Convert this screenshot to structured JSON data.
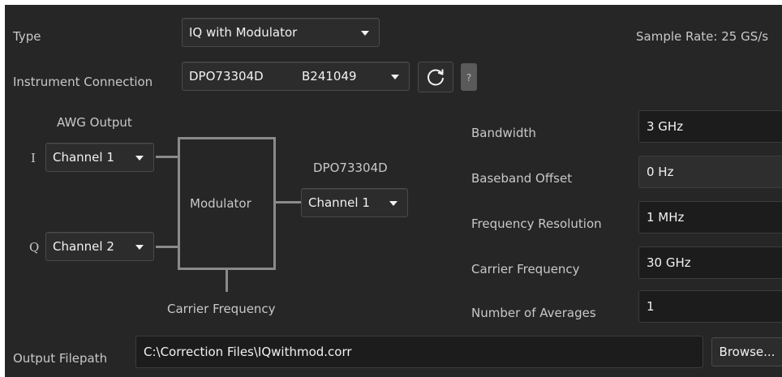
{
  "type": {
    "label": "Type",
    "value": "IQ with Modulator",
    "sample_rate": "Sample Rate:  25 GS/s"
  },
  "instrument": {
    "label": "Instrument Connection",
    "model": "DPO73304D",
    "serial": "B241049",
    "help": "?"
  },
  "diagram": {
    "awg_output": "AWG Output",
    "i_label": "I",
    "q_label": "Q",
    "i_channel": "Channel 1",
    "q_channel": "Channel 2",
    "modulator": "Modulator",
    "carrier_frequency": "Carrier Frequency",
    "scope_model": "DPO73304D",
    "scope_channel": "Channel 1"
  },
  "params": {
    "bandwidth_label": "Bandwidth",
    "bandwidth_value": "3 GHz",
    "baseband_offset_label": "Baseband Offset",
    "baseband_offset_value": "0 Hz",
    "freq_res_label": "Frequency Resolution",
    "freq_res_value": "1 MHz",
    "carrier_label": "Carrier Frequency",
    "carrier_value": "30 GHz",
    "averages_label": "Number of Averages",
    "averages_value": "1"
  },
  "output": {
    "label": "Output Filepath",
    "path": "C:\\Correction Files\\IQwithmod.corr",
    "browse": "Browse..."
  }
}
